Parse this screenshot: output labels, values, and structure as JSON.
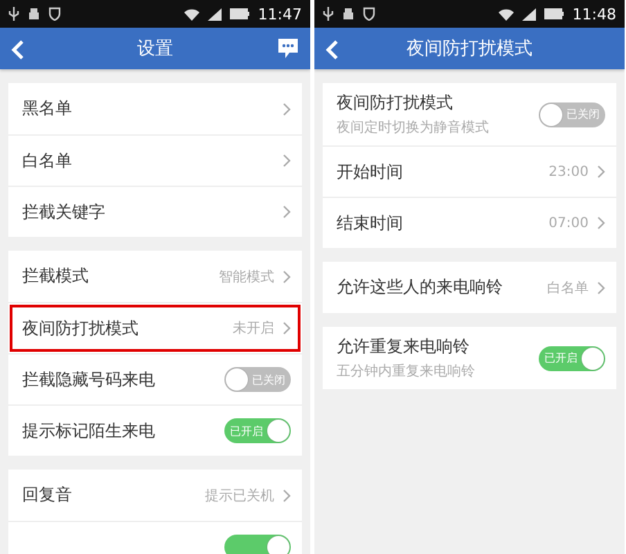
{
  "screens": [
    {
      "status_bar": {
        "time": "11:47"
      },
      "app_bar": {
        "title": "设置",
        "chat_button": true
      },
      "groups": [
        {
          "rows": [
            {
              "kind": "link",
              "label": "黑名单",
              "highlighted": false
            },
            {
              "kind": "link",
              "label": "白名单",
              "highlighted": false
            },
            {
              "kind": "link",
              "label": "拦截关键字",
              "highlighted": false
            }
          ]
        },
        {
          "rows": [
            {
              "kind": "link",
              "label": "拦截模式",
              "value": "智能模式",
              "highlighted": false
            },
            {
              "kind": "link",
              "label": "夜间防打扰模式",
              "value": "未开启",
              "highlighted": true
            },
            {
              "kind": "toggle",
              "label": "拦截隐藏号码来电",
              "on": false,
              "toggle_text": "已关闭",
              "highlighted": false
            },
            {
              "kind": "toggle",
              "label": "提示标记陌生来电",
              "on": true,
              "toggle_text": "已开启",
              "highlighted": false
            }
          ]
        },
        {
          "rows": [
            {
              "kind": "link",
              "label": "回复音",
              "value": "提示已关机",
              "highlighted": false
            },
            {
              "kind": "toggle",
              "on": true,
              "highlighted": false
            }
          ]
        }
      ]
    },
    {
      "status_bar": {
        "time": "11:48"
      },
      "app_bar": {
        "title": "夜间防打扰模式",
        "chat_button": false
      },
      "groups": [
        {
          "rows": [
            {
              "kind": "toggle",
              "label": "夜间防打扰模式",
              "sublabel": "夜间定时切换为静音模式",
              "on": false,
              "toggle_text": "已关闭",
              "highlighted": false
            },
            {
              "kind": "link",
              "label": "开始时间",
              "value": "23:00",
              "highlighted": false
            },
            {
              "kind": "link",
              "label": "结束时间",
              "value": "07:00",
              "highlighted": false
            }
          ]
        },
        {
          "rows": [
            {
              "kind": "link",
              "label": "允许这些人的来电响铃",
              "value": "白名单",
              "highlighted": false
            }
          ]
        },
        {
          "rows": [
            {
              "kind": "toggle",
              "label": "允许重复来电响铃",
              "sublabel": "五分钟内重复来电响铃",
              "on": true,
              "toggle_text": "已开启",
              "highlighted": false
            }
          ]
        }
      ]
    }
  ]
}
